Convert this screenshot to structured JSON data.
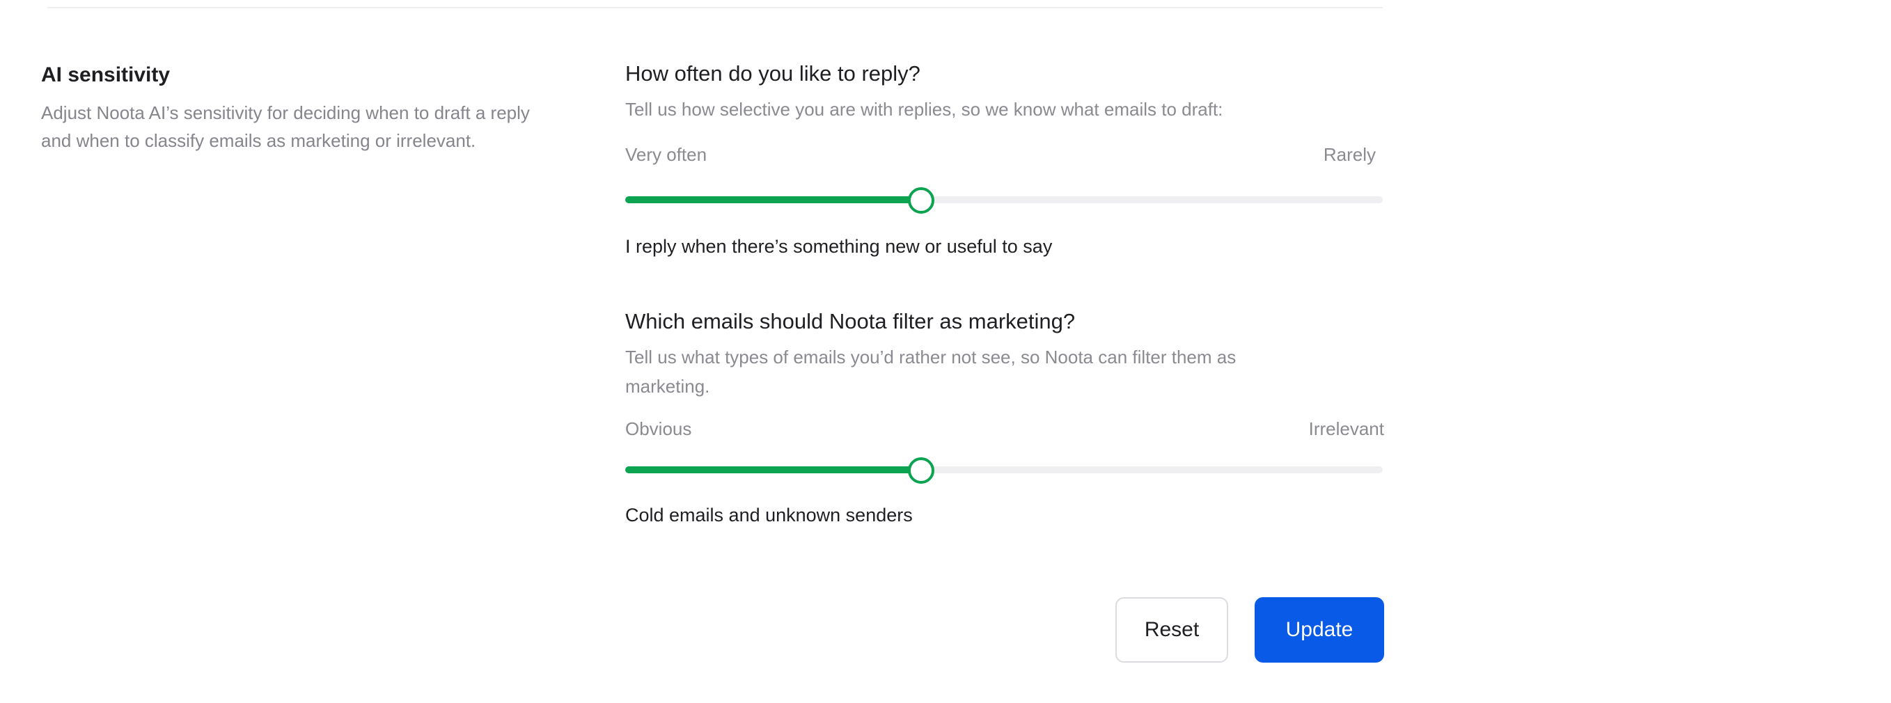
{
  "section": {
    "title": "AI sensitivity",
    "description": "Adjust Noota AI’s sensitivity for deciding when to draft a reply and when to classify emails as marketing or irrelevant."
  },
  "reply_question": {
    "title": "How often do you like to reply?",
    "subtitle": "Tell us how selective you are with replies, so we know what emails to draft:",
    "min_label": "Very often",
    "max_label": "Rarely",
    "value_fraction": 0.39,
    "value_text": "I reply when there’s something new or useful to say"
  },
  "marketing_question": {
    "title": "Which emails should Noota filter as marketing?",
    "subtitle": "Tell us what types of emails you’d rather not see, so Noota can filter them as marketing.",
    "min_label": "Obvious",
    "max_label": "Irrelevant",
    "value_fraction": 0.39,
    "value_text": "Cold emails and unknown senders"
  },
  "actions": {
    "reset_label": "Reset",
    "update_label": "Update"
  },
  "colors": {
    "accent_green": "#0ca451",
    "primary_blue": "#0a5ae8"
  }
}
